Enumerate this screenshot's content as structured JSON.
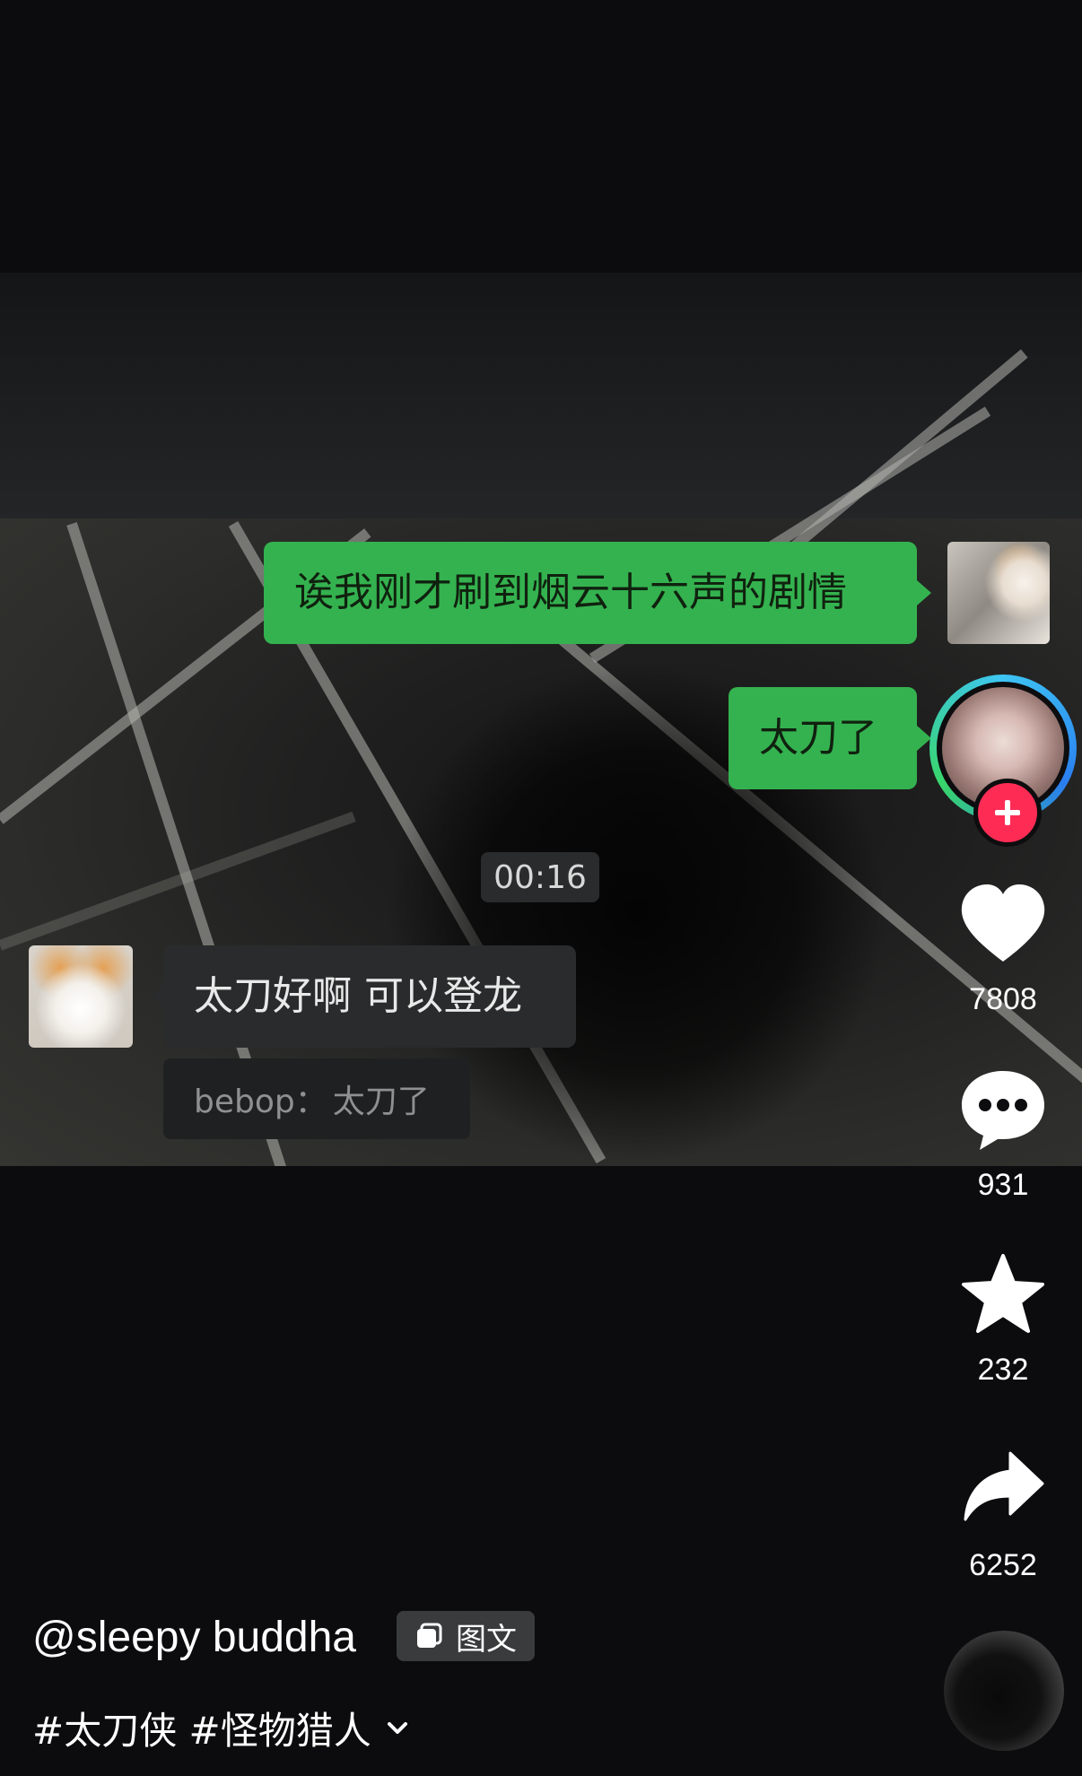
{
  "chat": {
    "msg1": "诶我刚才刷到烟云十六声的剧情",
    "msg2": "太刀了",
    "timestamp": "00:16",
    "reply": "太刀好啊 可以登龙",
    "quote_name": "bebop：",
    "quote_text": "太刀了"
  },
  "actions": {
    "likes": "7808",
    "comments": "931",
    "favorites": "232",
    "shares": "6252"
  },
  "post": {
    "username": "@sleepy buddha",
    "badge": "图文",
    "tags": "#太刀侠 #怪物猎人"
  },
  "icons": {
    "follow": "plus-icon",
    "like": "heart-icon",
    "comment": "comment-bubble-icon",
    "favorite": "star-icon",
    "share": "share-arrow-icon",
    "badge": "image-stack-icon",
    "expand": "chevron-down-icon"
  },
  "colors": {
    "green_bubble": "#34b24f",
    "follow_red": "#fe2c55",
    "background": "#0c0c0e"
  }
}
